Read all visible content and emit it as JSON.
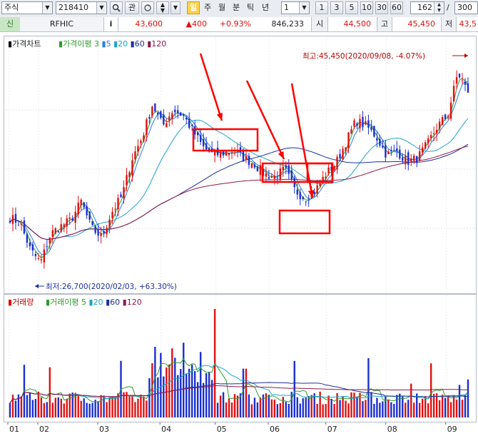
{
  "toolbar": {
    "market": "주식",
    "code": "218410",
    "search_icon": "magnifier-icon",
    "gwan": "관",
    "period_day": "일",
    "period_week": "주",
    "period_month": "월",
    "period_minute": "분",
    "period_tick": "틱",
    "period_year": "년",
    "interval_value": "1",
    "interval_options": [
      "1",
      "3",
      "5",
      "10",
      "30",
      "60"
    ],
    "count_value": "162",
    "slash": "/",
    "total_value": "300"
  },
  "infobar": {
    "credit": "신",
    "name": "RFHIC",
    "info_icon": "i",
    "price": "43,600",
    "change": "▲400",
    "change_pct": "+0.93%",
    "volume": "846,233",
    "open_label": "시",
    "open": "44,500",
    "high_label": "고",
    "high": "45,450",
    "low_label": "저",
    "low": "43,5"
  },
  "colors": {
    "up": "#e01010",
    "down": "#1a2fcf",
    "ma3_price": "#2e9b2e",
    "ma5": "#2a7de1",
    "ma20": "#1ea3c8",
    "ma60": "#1d2fa0",
    "ma120": "#8b1a4a",
    "annotation": "#ff0000"
  },
  "chart_data": [
    {
      "type": "candlestick",
      "title": "가격차트",
      "legend": [
        "가격이평 3",
        "5",
        "20",
        "60",
        "120"
      ],
      "x_ticks": [
        "01",
        "02",
        "03",
        "04",
        "05",
        "06",
        "07",
        "08",
        "09"
      ],
      "high_label": "최고:45,450(2020/09/08, -4.07%)",
      "low_label": "최저:26,700(2020/02/03, +63.30%)",
      "high_value": 45450,
      "low_value": 26700,
      "ylim": [
        25500,
        47500
      ],
      "series_close_weekly": [
        32000,
        31500,
        29000,
        27800,
        30500,
        31200,
        31800,
        33500,
        31000,
        30200,
        32500,
        34000,
        37500,
        39500,
        42500,
        40500,
        42000,
        41500,
        40000,
        38500,
        37800,
        38000,
        38200,
        37500,
        37000,
        36000,
        35800,
        36500,
        34500,
        33800,
        34500,
        36000,
        37000,
        39000,
        41000,
        40500,
        39500,
        37800,
        38200,
        37200,
        37500,
        38800,
        40500,
        41500,
        45450,
        43600
      ],
      "annotations": [
        "red-arrow-1",
        "red-arrow-2",
        "red-arrow-3",
        "red-box-1",
        "red-box-2",
        "red-box-3",
        "red-box-4"
      ]
    },
    {
      "type": "bar",
      "title": "거래량",
      "legend": [
        "거래이평 5",
        "20",
        "60",
        "120"
      ],
      "x_ticks": [
        "01",
        "02",
        "03",
        "04",
        "05",
        "06",
        "07",
        "08",
        "09"
      ]
    }
  ]
}
